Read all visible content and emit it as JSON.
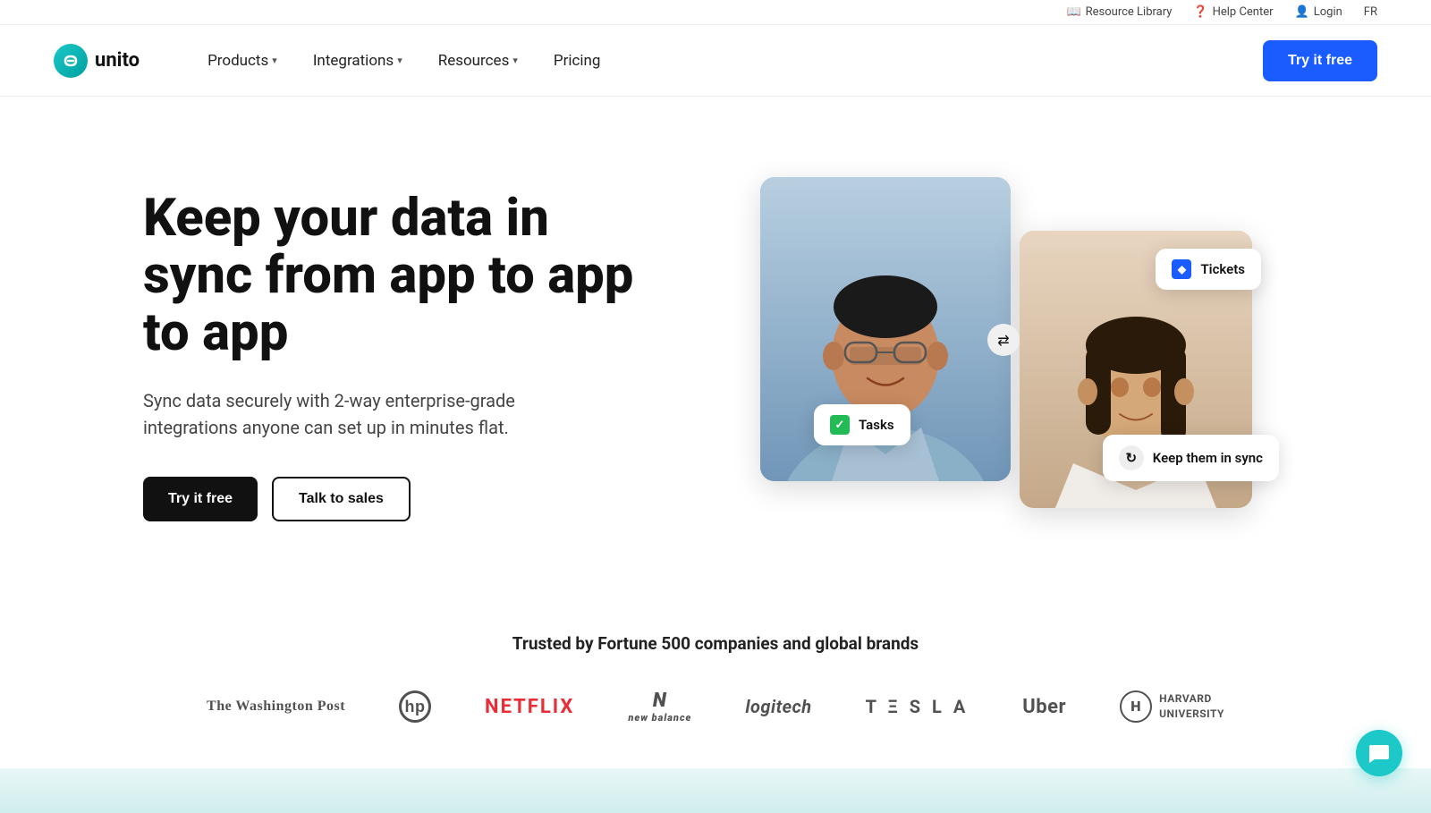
{
  "topbar": {
    "help_center": "Help Center",
    "login": "Login",
    "language": "FR",
    "resource_library": "Resource Library"
  },
  "navbar": {
    "logo_text": "unito",
    "nav_items": [
      {
        "label": "Products",
        "has_dropdown": true
      },
      {
        "label": "Integrations",
        "has_dropdown": true
      },
      {
        "label": "Resources",
        "has_dropdown": true
      },
      {
        "label": "Pricing",
        "has_dropdown": false
      }
    ],
    "cta_label": "Try it free"
  },
  "hero": {
    "title": "Keep your data in sync from app to app to app",
    "subtitle": "Sync data securely with 2-way enterprise-grade integrations anyone can set up in minutes flat.",
    "cta_primary": "Try it free",
    "cta_secondary": "Talk to sales",
    "badge_tasks": "Tasks",
    "badge_tickets": "Tickets",
    "badge_sync": "Keep them in sync"
  },
  "trusted": {
    "title": "Trusted by Fortune 500 companies and global brands",
    "brands": [
      {
        "name": "The Washington Post",
        "style": "washington-post"
      },
      {
        "name": "hp",
        "style": "hp"
      },
      {
        "name": "NETFLIX",
        "style": "netflix"
      },
      {
        "name": "new balance",
        "style": "newbalance"
      },
      {
        "name": "logitech",
        "style": "logitech"
      },
      {
        "name": "TESLA",
        "style": "tesla"
      },
      {
        "name": "Uber",
        "style": "uber"
      },
      {
        "name": "HARVARD UNIVERSITY",
        "style": "harvard"
      }
    ]
  },
  "chat": {
    "icon": "💬"
  }
}
